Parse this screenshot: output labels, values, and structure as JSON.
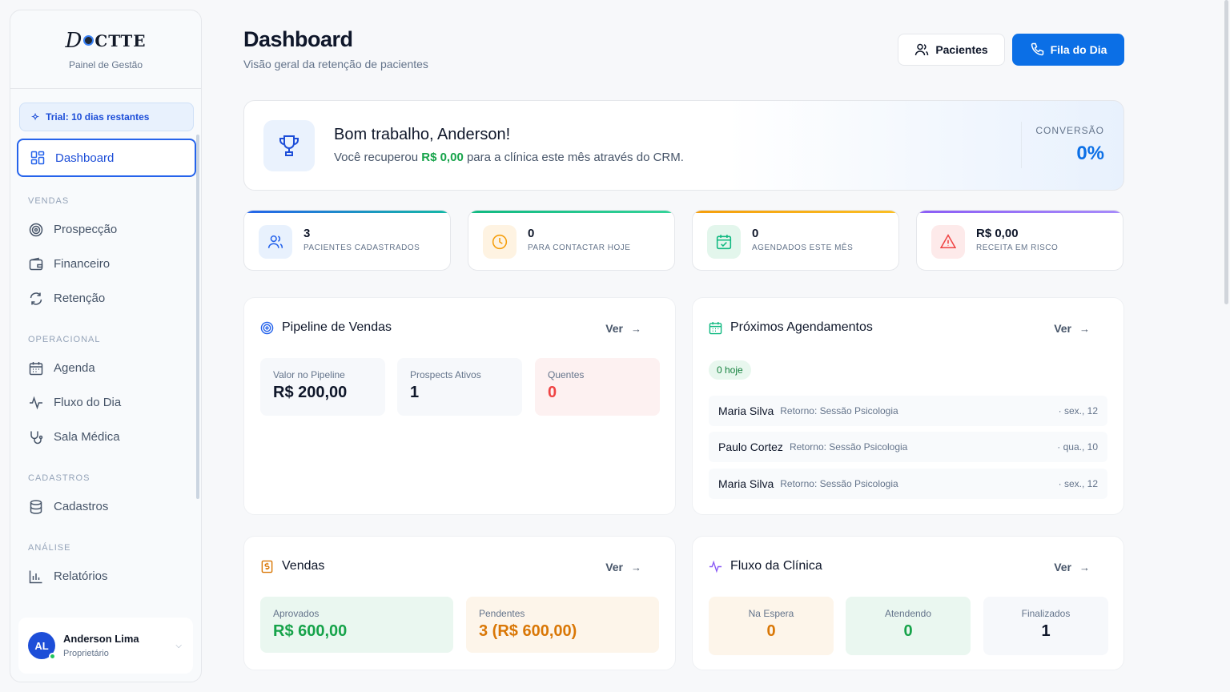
{
  "sidebar": {
    "logo_text": "CTTE",
    "logo_sub": "Painel de Gestão",
    "trial": "Trial: 10 dias restantes",
    "items": {
      "dashboard": "Dashboard",
      "vendas_section": "VENDAS",
      "prospeccao": "Prospecção",
      "financeiro": "Financeiro",
      "retencao": "Retenção",
      "operacional_section": "OPERACIONAL",
      "agenda": "Agenda",
      "fluxo": "Fluxo do Dia",
      "sala": "Sala Médica",
      "cadastros_section": "CADASTROS",
      "cadastros": "Cadastros",
      "analise_section": "ANÁLISE",
      "relatorios": "Relatórios"
    },
    "user": {
      "initials": "AL",
      "name": "Anderson Lima",
      "role": "Proprietário"
    }
  },
  "header": {
    "title": "Dashboard",
    "subtitle": "Visão geral da retenção de pacientes",
    "btn_pacientes": "Pacientes",
    "btn_fila": "Fila do Dia"
  },
  "welcome": {
    "title": "Bom trabalho, Anderson!",
    "text_pre": "Você recuperou ",
    "amount": "R$ 0,00",
    "text_post": " para a clínica este mês através do CRM.",
    "conv_label": "CONVERSÃO",
    "conv_value": "0%"
  },
  "stats": [
    {
      "value": "3",
      "label": "PACIENTES CADASTRADOS",
      "color": "#2563eb"
    },
    {
      "value": "0",
      "label": "PARA CONTACTAR HOJE",
      "color": "#f59e0b"
    },
    {
      "value": "0",
      "label": "AGENDADOS ESTE MÊS",
      "color": "#10b981"
    },
    {
      "value": "R$ 0,00",
      "label": "RECEITA EM RISCO",
      "color": "#8b5cf6"
    }
  ],
  "pipeline": {
    "title": "Pipeline de Vendas",
    "ver": "Ver",
    "boxes": [
      {
        "label": "Valor no Pipeline",
        "value": "R$ 200,00"
      },
      {
        "label": "Prospects Ativos",
        "value": "1"
      },
      {
        "label": "Quentes",
        "value": "0"
      }
    ]
  },
  "agendamentos": {
    "title": "Próximos Agendamentos",
    "ver": "Ver",
    "hoje_badge": "0 hoje",
    "items": [
      {
        "name": "Maria Silva",
        "type": "Retorno: Sessão Psicologia",
        "date": "· sex., 12"
      },
      {
        "name": "Paulo Cortez",
        "type": "Retorno: Sessão Psicologia",
        "date": "· qua., 10"
      },
      {
        "name": "Maria Silva",
        "type": "Retorno: Sessão Psicologia",
        "date": "· sex., 12"
      }
    ]
  },
  "vendas": {
    "title": "Vendas",
    "ver": "Ver",
    "aprovados_label": "Aprovados",
    "aprovados_value": "R$ 600,00",
    "pendentes_label": "Pendentes",
    "pendentes_value": "3 (R$ 600,00)"
  },
  "fluxo": {
    "title": "Fluxo da Clínica",
    "ver": "Ver",
    "boxes": [
      {
        "label": "Na Espera",
        "value": "0"
      },
      {
        "label": "Atendendo",
        "value": "0"
      },
      {
        "label": "Finalizados",
        "value": "1"
      }
    ]
  },
  "colors": {
    "primary": "#0b6fe6",
    "success": "#16a34a",
    "warning": "#d97706",
    "danger": "#ef4444"
  }
}
